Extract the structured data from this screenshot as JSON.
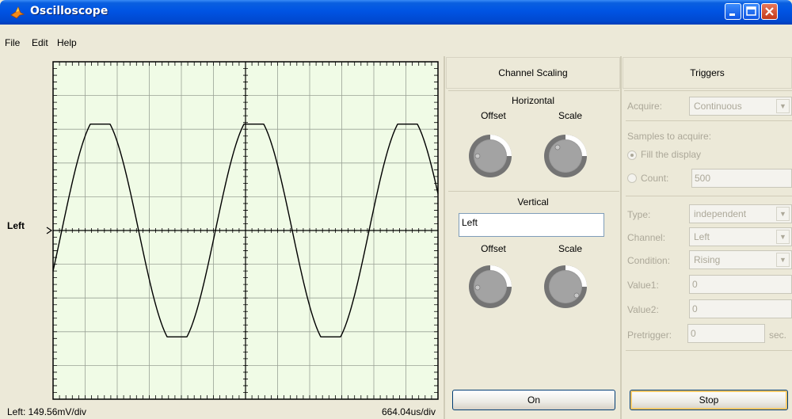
{
  "window": {
    "title": "Oscilloscope",
    "controls": [
      "minimize",
      "maximize",
      "close"
    ]
  },
  "menu": {
    "items": [
      "File",
      "Edit",
      "Help"
    ]
  },
  "scope": {
    "channel_label": "Left",
    "vertical_status": "Left: 149.56mV/div",
    "horizontal_status": "664.04us/div",
    "colors": {
      "screen": "#f0fbe6",
      "grid": "#9aa296",
      "trace": "#000000"
    }
  },
  "channel_scaling": {
    "header": "Channel Scaling",
    "horizontal": {
      "title": "Horizontal",
      "offset_label": "Offset",
      "scale_label": "Scale"
    },
    "vertical": {
      "title": "Vertical",
      "channel_value": "Left",
      "offset_label": "Offset",
      "scale_label": "Scale"
    },
    "on_button": "On"
  },
  "triggers": {
    "header": "Triggers",
    "acquire_label": "Acquire:",
    "acquire_value": "Continuous",
    "samples_label": "Samples to acquire:",
    "fill_label": "Fill the display",
    "count_label": "Count:",
    "count_value": "500",
    "type_label": "Type:",
    "type_value": "independent",
    "channel_label": "Channel:",
    "channel_value": "Left",
    "condition_label": "Condition:",
    "condition_value": "Rising",
    "value1_label": "Value1:",
    "value1_value": "0",
    "value2_label": "Value2:",
    "value2_value": "0",
    "pretrigger_label": "Pretrigger:",
    "pretrigger_value": "0",
    "pretrigger_unit": "sec.",
    "stop_button": "Stop"
  }
}
